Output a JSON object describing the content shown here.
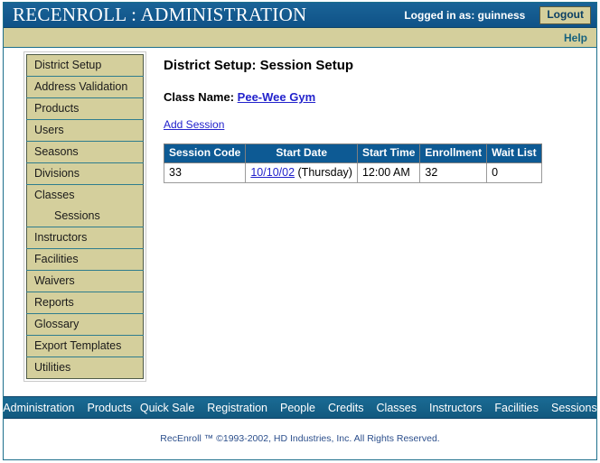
{
  "header": {
    "app_title": "RECENROLL : ADMINISTRATION",
    "login_status": "Logged in as: guinness",
    "logout_label": "Logout",
    "help_label": "Help"
  },
  "sidebar": {
    "items": [
      {
        "label": "District Setup"
      },
      {
        "label": "Address Validation"
      },
      {
        "label": "Products"
      },
      {
        "label": "Users"
      },
      {
        "label": "Seasons"
      },
      {
        "label": "Divisions"
      },
      {
        "label": "Classes"
      },
      {
        "label": "Sessions"
      },
      {
        "label": "Instructors"
      },
      {
        "label": "Facilities"
      },
      {
        "label": "Waivers"
      },
      {
        "label": "Reports"
      },
      {
        "label": "Glossary"
      },
      {
        "label": "Export Templates"
      },
      {
        "label": "Utilities"
      }
    ]
  },
  "main": {
    "page_heading": "District Setup: Session Setup",
    "class_name_label": "Class Name:",
    "class_name_value": "Pee-Wee Gym",
    "add_session_label": "Add Session",
    "table": {
      "columns": [
        "Session Code",
        "Start Date",
        "Start Time",
        "Enrollment",
        "Wait List"
      ],
      "rows": [
        {
          "session_code": "33",
          "start_date_link": "10/10/02",
          "start_date_day": "(Thursday)",
          "start_time": "12:00 AM",
          "enrollment": "32",
          "wait_list": "0"
        }
      ]
    }
  },
  "footer": {
    "nav": [
      "Administration",
      "Products",
      "Quick Sale",
      "Registration",
      "People",
      "Credits",
      "Classes",
      "Instructors",
      "Facilities",
      "Sessions"
    ],
    "copyright": "RecEnroll ™ ©1993-2002,  HD Industries, Inc.  All Rights Reserved."
  },
  "colors": {
    "titlebar_blue": "#1a5f91",
    "tan_bar": "#d4cf9c",
    "link_blue": "#2222cc",
    "table_header_blue": "#0d5a94",
    "help_teal": "#17637f",
    "copyright_blue": "#2c4f8c"
  }
}
